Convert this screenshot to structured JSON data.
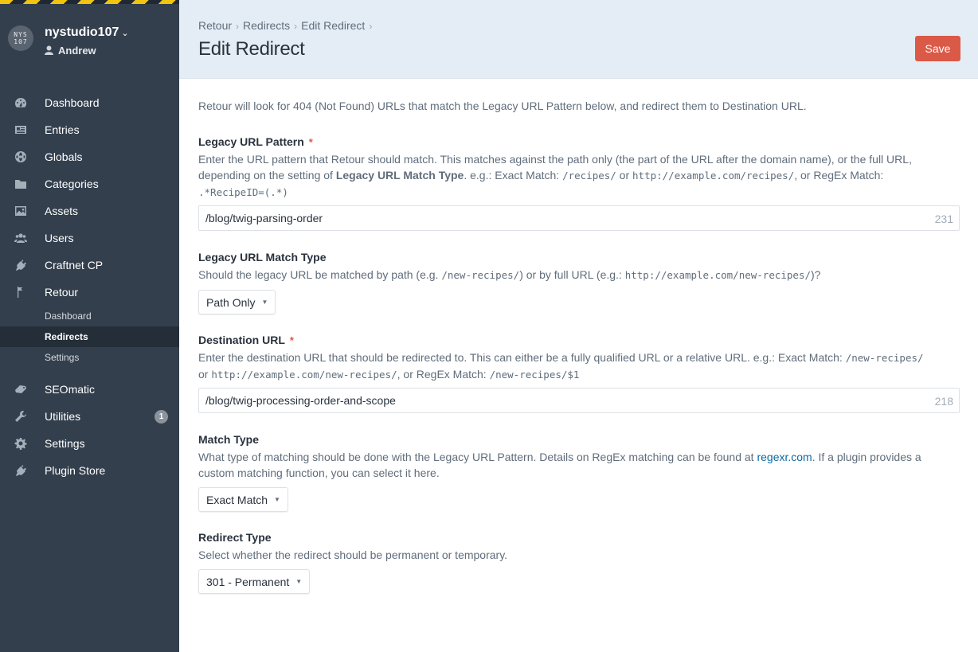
{
  "sidebar": {
    "site_name": "nystudio107",
    "user_name": "Andrew",
    "logo_text": "NYS 107",
    "nav": [
      {
        "label": "Dashboard",
        "icon": "dashboard-icon"
      },
      {
        "label": "Entries",
        "icon": "entries-icon"
      },
      {
        "label": "Globals",
        "icon": "globe-icon"
      },
      {
        "label": "Categories",
        "icon": "folder-icon"
      },
      {
        "label": "Assets",
        "icon": "image-icon"
      },
      {
        "label": "Users",
        "icon": "users-icon"
      },
      {
        "label": "Craftnet CP",
        "icon": "plug-icon"
      },
      {
        "label": "Retour",
        "icon": "signpost-icon"
      }
    ],
    "retour_sub": [
      {
        "label": "Dashboard"
      },
      {
        "label": "Redirects",
        "active": true
      },
      {
        "label": "Settings"
      }
    ],
    "nav2": [
      {
        "label": "SEOmatic",
        "icon": "seomatic-icon"
      },
      {
        "label": "Utilities",
        "icon": "wrench-icon",
        "badge": "1"
      },
      {
        "label": "Settings",
        "icon": "gear-icon"
      },
      {
        "label": "Plugin Store",
        "icon": "plug-icon"
      }
    ]
  },
  "header": {
    "breadcrumbs": [
      "Retour",
      "Redirects",
      "Edit Redirect"
    ],
    "title": "Edit Redirect",
    "save_label": "Save"
  },
  "content": {
    "intro": "Retour will look for 404 (Not Found) URLs that match the Legacy URL Pattern below, and redirect them to Destination URL.",
    "legacy": {
      "label": "Legacy URL Pattern",
      "required": "*",
      "i1": "Enter the URL pattern that Retour should match. This matches against the path only (the part of the URL after the domain name), or the full URL,",
      "i2a": "depending on the setting of ",
      "i2b": "Legacy URL Match Type",
      "i2c": ". e.g.: Exact Match: ",
      "i2d": "/recipes/",
      "i2e": " or ",
      "i2f": "http://example.com/recipes/",
      "i2g": ", or RegEx Match:",
      "i3": ".*RecipeID=(.*)",
      "value": "/blog/twig-parsing-order",
      "count": "231"
    },
    "match_type_legacy": {
      "label": "Legacy URL Match Type",
      "i1a": "Should the legacy URL be matched by path (e.g. ",
      "i1b": "/new-recipes/",
      "i1c": ") or by full URL (e.g.: ",
      "i1d": "http://example.com/new-recipes/",
      "i1e": ")?",
      "value": "Path Only"
    },
    "destination": {
      "label": "Destination URL",
      "required": "*",
      "i1a": "Enter the destination URL that should be redirected to. This can either be a fully qualified URL or a relative URL. e.g.: Exact Match: ",
      "i1b": "/new-recipes/",
      "i2a": "or ",
      "i2b": "http://example.com/new-recipes/",
      "i2c": ", or RegEx Match: ",
      "i2d": "/new-recipes/$1",
      "value": "/blog/twig-processing-order-and-scope",
      "count": "218"
    },
    "match_type": {
      "label": "Match Type",
      "i1a": "What type of matching should be done with the Legacy URL Pattern. Details on RegEx matching can be found at ",
      "i1b": "regexr.com",
      "i1c": ". If a plugin provides a",
      "i2": "custom matching function, you can select it here.",
      "value": "Exact Match"
    },
    "redirect_type": {
      "label": "Redirect Type",
      "i1": "Select whether the redirect should be permanent or temporary.",
      "value": "301 - Permanent"
    }
  },
  "colors": {
    "sidebar_bg": "#333f4d",
    "header_bg": "#e4edf6",
    "save_button": "#da5a47",
    "link": "#0b69a3"
  }
}
